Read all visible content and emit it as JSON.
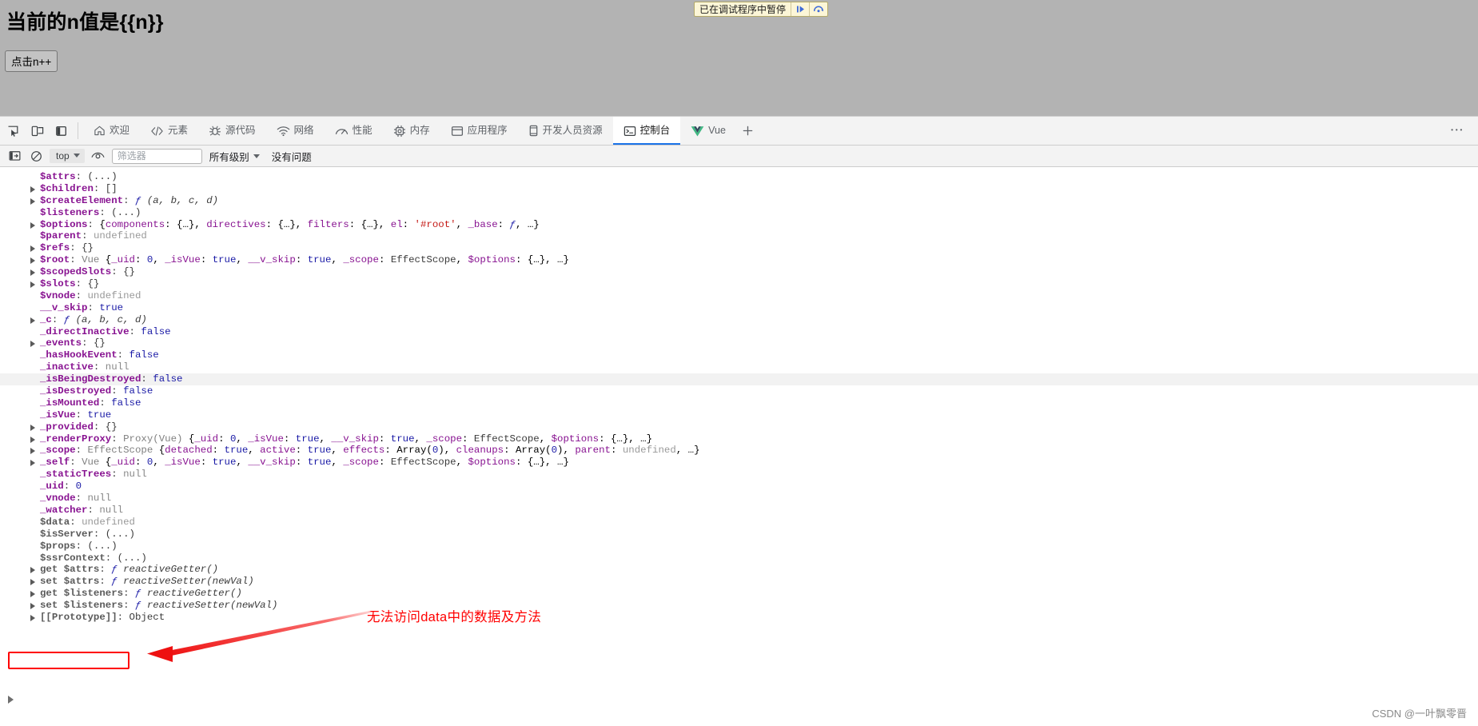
{
  "page": {
    "heading": "当前的n值是{{n}}",
    "button_label": "点击n++"
  },
  "paused_banner": {
    "text": "已在调试程序中暂停",
    "resume_icon": "resume-script-icon",
    "step_over_icon": "step-over-icon"
  },
  "devtools": {
    "dock_buttons": [
      {
        "name": "inspect-element-icon",
        "title": "检查元素"
      },
      {
        "name": "device-toolbar-icon",
        "title": "切换设备工具栏"
      },
      {
        "name": "dock-side-icon",
        "title": "停靠位置"
      }
    ],
    "tabs": [
      {
        "label": "欢迎",
        "icon": "home-icon",
        "active": false
      },
      {
        "label": "元素",
        "icon": "code-brackets-icon",
        "active": false
      },
      {
        "label": "源代码",
        "icon": "bug-icon",
        "active": false
      },
      {
        "label": "网络",
        "icon": "wifi-icon",
        "active": false
      },
      {
        "label": "性能",
        "icon": "gauge-icon",
        "active": false
      },
      {
        "label": "内存",
        "icon": "chip-icon",
        "active": false
      },
      {
        "label": "应用程序",
        "icon": "window-icon",
        "active": false
      },
      {
        "label": "开发人员资源",
        "icon": "device-icon",
        "active": false
      },
      {
        "label": "控制台",
        "icon": "console-prompt-icon",
        "active": true
      },
      {
        "label": "Vue",
        "icon": "vue-logo-icon",
        "active": false
      }
    ],
    "add_tab_icon": "plus-icon",
    "more_options_icon": "kebab-menu-icon",
    "console_toolbar": {
      "sidebar_toggle_icon": "show-console-sidebar-icon",
      "clear_icon": "clear-console-icon",
      "context": "top",
      "context_caret_icon": "chevron-down-icon",
      "live_expression_icon": "eye-icon",
      "filter_placeholder": "筛选器",
      "filter_value": "",
      "level_label": "所有级别",
      "level_caret_icon": "chevron-down-icon",
      "issues_label": "没有问题"
    }
  },
  "console_output": {
    "prompt_icon": "prompt-chevron-icon",
    "rows": [
      {
        "expandable": false,
        "key": "$attrs",
        "key_style": "k",
        "value": "(...)",
        "value_style": "v-obj"
      },
      {
        "expandable": true,
        "key": "$children",
        "key_style": "k",
        "value": "[]",
        "value_style": "v-obj"
      },
      {
        "expandable": true,
        "key": "$createElement",
        "key_style": "k",
        "value": "ƒ (a, b, c, d)",
        "value_style": "fn"
      },
      {
        "expandable": false,
        "key": "$listeners",
        "key_style": "k",
        "value": "(...)",
        "value_style": "v-obj"
      },
      {
        "expandable": true,
        "key": "$options",
        "key_style": "k",
        "value": "{components: {…}, directives: {…}, filters: {…}, el: '#root', _base: ƒ, …}",
        "value_style": "mixed"
      },
      {
        "expandable": false,
        "key": "$parent",
        "key_style": "k",
        "value": "undefined",
        "value_style": "v-undef"
      },
      {
        "expandable": true,
        "key": "$refs",
        "key_style": "k",
        "value": "{}",
        "value_style": "v-obj"
      },
      {
        "expandable": true,
        "key": "$root",
        "key_style": "k",
        "value": "Vue {_uid: 0, _isVue: true, __v_skip: true, _scope: EffectScope, $options: {…}, …}",
        "value_style": "mixed"
      },
      {
        "expandable": true,
        "key": "$scopedSlots",
        "key_style": "k",
        "value": "{}",
        "value_style": "v-obj"
      },
      {
        "expandable": true,
        "key": "$slots",
        "key_style": "k",
        "value": "{}",
        "value_style": "v-obj"
      },
      {
        "expandable": false,
        "key": "$vnode",
        "key_style": "k",
        "value": "undefined",
        "value_style": "v-undef"
      },
      {
        "expandable": false,
        "key": "__v_skip",
        "key_style": "k",
        "value": "true",
        "value_style": "v-bool"
      },
      {
        "expandable": true,
        "key": "_c",
        "key_style": "k",
        "value": "ƒ (a, b, c, d)",
        "value_style": "fn"
      },
      {
        "expandable": false,
        "key": "_directInactive",
        "key_style": "k",
        "value": "false",
        "value_style": "v-bool"
      },
      {
        "expandable": true,
        "key": "_events",
        "key_style": "k",
        "value": "{}",
        "value_style": "v-obj"
      },
      {
        "expandable": false,
        "key": "_hasHookEvent",
        "key_style": "k",
        "value": "false",
        "value_style": "v-bool"
      },
      {
        "expandable": false,
        "key": "_inactive",
        "key_style": "k",
        "value": "null",
        "value_style": "v-null"
      },
      {
        "expandable": false,
        "key": "_isBeingDestroyed",
        "key_style": "k",
        "value": "false",
        "value_style": "v-bool",
        "highlight": true
      },
      {
        "expandable": false,
        "key": "_isDestroyed",
        "key_style": "k",
        "value": "false",
        "value_style": "v-bool"
      },
      {
        "expandable": false,
        "key": "_isMounted",
        "key_style": "k",
        "value": "false",
        "value_style": "v-bool"
      },
      {
        "expandable": false,
        "key": "_isVue",
        "key_style": "k",
        "value": "true",
        "value_style": "v-bool"
      },
      {
        "expandable": true,
        "key": "_provided",
        "key_style": "k",
        "value": "{}",
        "value_style": "v-obj"
      },
      {
        "expandable": true,
        "key": "_renderProxy",
        "key_style": "k",
        "value": "Proxy(Vue) {_uid: 0, _isVue: true, __v_skip: true, _scope: EffectScope, $options: {…}, …}",
        "value_style": "mixed"
      },
      {
        "expandable": true,
        "key": "_scope",
        "key_style": "k",
        "value": "EffectScope {detached: true, active: true, effects: Array(0), cleanups: Array(0), parent: undefined, …}",
        "value_style": "mixed"
      },
      {
        "expandable": true,
        "key": "_self",
        "key_style": "k",
        "value": "Vue {_uid: 0, _isVue: true, __v_skip: true, _scope: EffectScope, $options: {…}, …}",
        "value_style": "mixed"
      },
      {
        "expandable": false,
        "key": "_staticTrees",
        "key_style": "k",
        "value": "null",
        "value_style": "v-null"
      },
      {
        "expandable": false,
        "key": "_uid",
        "key_style": "k",
        "value": "0",
        "value_style": "v-num"
      },
      {
        "expandable": false,
        "key": "_vnode",
        "key_style": "k",
        "value": "null",
        "value_style": "v-null"
      },
      {
        "expandable": false,
        "key": "_watcher",
        "key_style": "k",
        "value": "null",
        "value_style": "v-null"
      },
      {
        "expandable": false,
        "key": "$data",
        "key_style": "k-dim",
        "value": "undefined",
        "value_style": "v-undef",
        "boxed": true
      },
      {
        "expandable": false,
        "key": "$isServer",
        "key_style": "k-dim",
        "value": "(...)",
        "value_style": "v-obj"
      },
      {
        "expandable": false,
        "key": "$props",
        "key_style": "k-dim",
        "value": "(...)",
        "value_style": "v-obj"
      },
      {
        "expandable": false,
        "key": "$ssrContext",
        "key_style": "k-dim",
        "value": "(...)",
        "value_style": "v-obj"
      },
      {
        "expandable": true,
        "key": "get $attrs",
        "key_style": "k-dim",
        "value": "ƒ reactiveGetter()",
        "value_style": "fn"
      },
      {
        "expandable": true,
        "key": "set $attrs",
        "key_style": "k-dim",
        "value": "ƒ reactiveSetter(newVal)",
        "value_style": "fn"
      },
      {
        "expandable": true,
        "key": "get $listeners",
        "key_style": "k-dim",
        "value": "ƒ reactiveGetter()",
        "value_style": "fn"
      },
      {
        "expandable": true,
        "key": "set $listeners",
        "key_style": "k-dim",
        "value": "ƒ reactiveSetter(newVal)",
        "value_style": "fn"
      },
      {
        "expandable": true,
        "key": "[[Prototype]]",
        "key_style": "k-proto",
        "value": "Object",
        "value_style": "v-obj"
      }
    ]
  },
  "annotation": {
    "text": "无法访问data中的数据及方法",
    "color": "#ff0000",
    "arrow_icon": "red-arrow-icon",
    "box_target": "$data"
  },
  "watermark": "CSDN @一叶飘零晋"
}
